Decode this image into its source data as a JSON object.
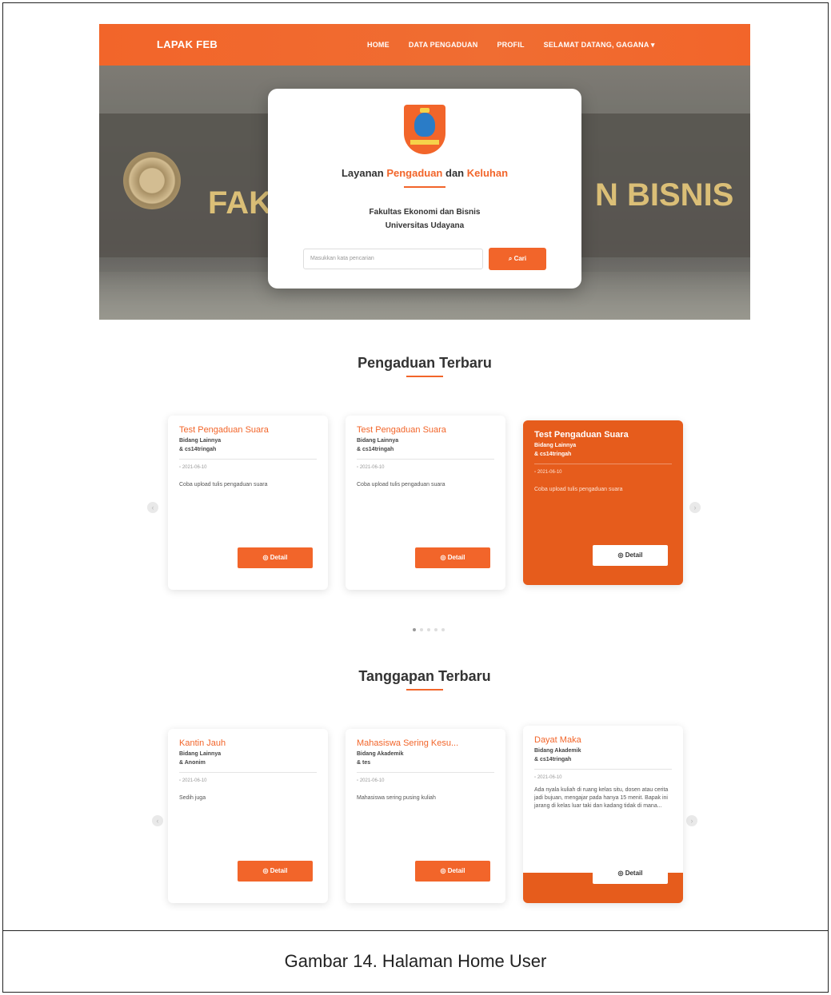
{
  "navbar": {
    "brand": "LAPAK FEB",
    "items": [
      "HOME",
      "DATA PENGADUAN",
      "PROFIL",
      "SELAMAT DATANG, GAGANA"
    ],
    "accent": "#f2652a"
  },
  "hero": {
    "bg_left_text": "FAK",
    "bg_right_text": "N BISNIS",
    "title_parts": [
      "Layanan ",
      "Pengaduan",
      " dan ",
      "Keluhan"
    ],
    "subtitle_line1": "Fakultas Ekonomi dan Bisnis",
    "subtitle_line2": "Universitas Udayana",
    "search_placeholder": "Masukkan kata pencarian",
    "search_button": "Cari"
  },
  "pengaduan": {
    "heading": "Pengaduan Terbaru",
    "cards": [
      {
        "title": "Test Pengaduan Suara",
        "field": "Bidang Lainnya",
        "user": "& cs14tringah",
        "date": "2021-06-10",
        "body": "Coba upload tulis pengaduan suara",
        "button": "Detail"
      },
      {
        "title": "Test Pengaduan Suara",
        "field": "Bidang Lainnya",
        "user": "& cs14tringah",
        "date": "2021-06-10",
        "body": "Coba upload tulis pengaduan suara",
        "button": "Detail"
      },
      {
        "title": "Test Pengaduan Suara",
        "field": "Bidang Lainnya",
        "user": "& cs14tringah",
        "date": "2021-06-10",
        "body": "Coba upload tulis pengaduan suara",
        "button": "Detail"
      }
    ]
  },
  "tanggapan": {
    "heading": "Tanggapan Terbaru",
    "cards": [
      {
        "title": "Kantin Jauh",
        "field": "Bidang Lainnya",
        "user": "& Anonim",
        "date": "2021-06-10",
        "body": "Sedih juga",
        "button": "Detail"
      },
      {
        "title": "Mahasiswa Sering Kesu...",
        "field": "Bidang Akademik",
        "user": "& tes",
        "date": "2021-06-10",
        "body": "Mahasiswa sering pusing kuliah",
        "button": "Detail"
      },
      {
        "title": "Dayat Maka",
        "field": "Bidang Akademik",
        "user": "& cs14tringah",
        "date": "2021-06-10",
        "body": "Ada nyala kuliah di ruang kelas situ, dosen atau cerita jadi bujuan, mengajar pada hanya 15 menit. Bapak ini jarang di kelas luar taki dan kadang tidak di mana...",
        "button": "Detail"
      }
    ]
  },
  "caption": "Gambar 14. Halaman Home User"
}
